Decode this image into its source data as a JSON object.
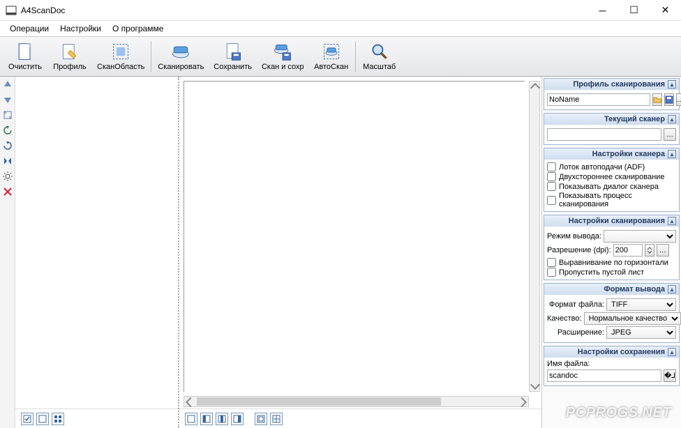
{
  "titlebar": {
    "title": "A4ScanDoc"
  },
  "menu": {
    "operations": "Операции",
    "settings": "Настройки",
    "about": "О программе"
  },
  "toolbar": {
    "clear": "Очистить",
    "profile": "Профиль",
    "scanarea": "СканОбласть",
    "scan": "Сканировать",
    "save": "Сохранить",
    "scansave": "Скан и сохр",
    "autoscan": "АвтоСкан",
    "zoom": "Масштаб"
  },
  "panels": {
    "profile": {
      "title": "Профиль сканирования",
      "name": "NoName"
    },
    "scanner": {
      "title": "Текущий сканер",
      "value": ""
    },
    "scanner_settings": {
      "title": "Настройки сканера",
      "adf": "Лоток автоподачи (ADF)",
      "duplex": "Двухстороннее сканирование",
      "showdialog": "Показывать диалог сканера",
      "showprocess": "Показывать процесс сканирования"
    },
    "scan_settings": {
      "title": "Настройки сканирования",
      "outputmode_label": "Режим вывода:",
      "outputmode": "",
      "dpi_label": "Разрешение (dpi):",
      "dpi": "200",
      "halign": "Выравнивание по горизонтали",
      "skipblank": "Пропустить пустой лист"
    },
    "output_format": {
      "title": "Формат вывода",
      "fileformat_label": "Формат файла:",
      "fileformat": "TIFF",
      "quality_label": "Качество:",
      "quality": "Нормальное качество",
      "extension_label": "Расширение:",
      "extension": "JPEG"
    },
    "save_settings": {
      "title": "Настройки сохранения",
      "filename_label": "Имя файла:",
      "filename": "scandoc"
    }
  },
  "watermark": "PCPROGS.NET"
}
